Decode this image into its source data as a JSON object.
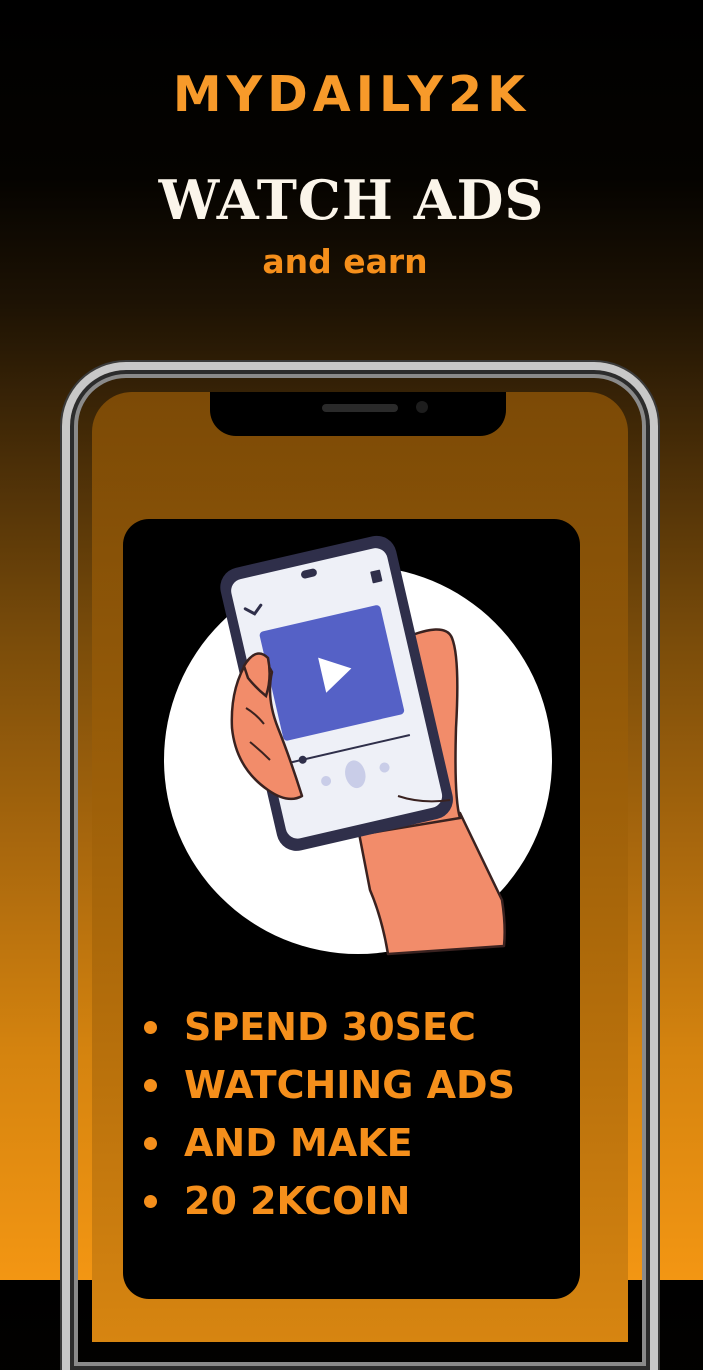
{
  "brand": "MYDAILY2K",
  "headline": "WATCH ADS",
  "subheadline": "and earn",
  "bullets": [
    {
      "text": "SPEND 30SEC"
    },
    {
      "text": "WATCHING ADS"
    },
    {
      "text": "AND MAKE"
    },
    {
      "text": "20 2KCOIN"
    }
  ],
  "colors": {
    "accent": "#f58f1b",
    "headline": "#fbf5ea",
    "background_top": "#000000",
    "background_bottom": "#f39613",
    "card": "#000000"
  },
  "illustration": {
    "icons": [
      "play-icon",
      "chevron-down-icon",
      "share-icon"
    ]
  }
}
